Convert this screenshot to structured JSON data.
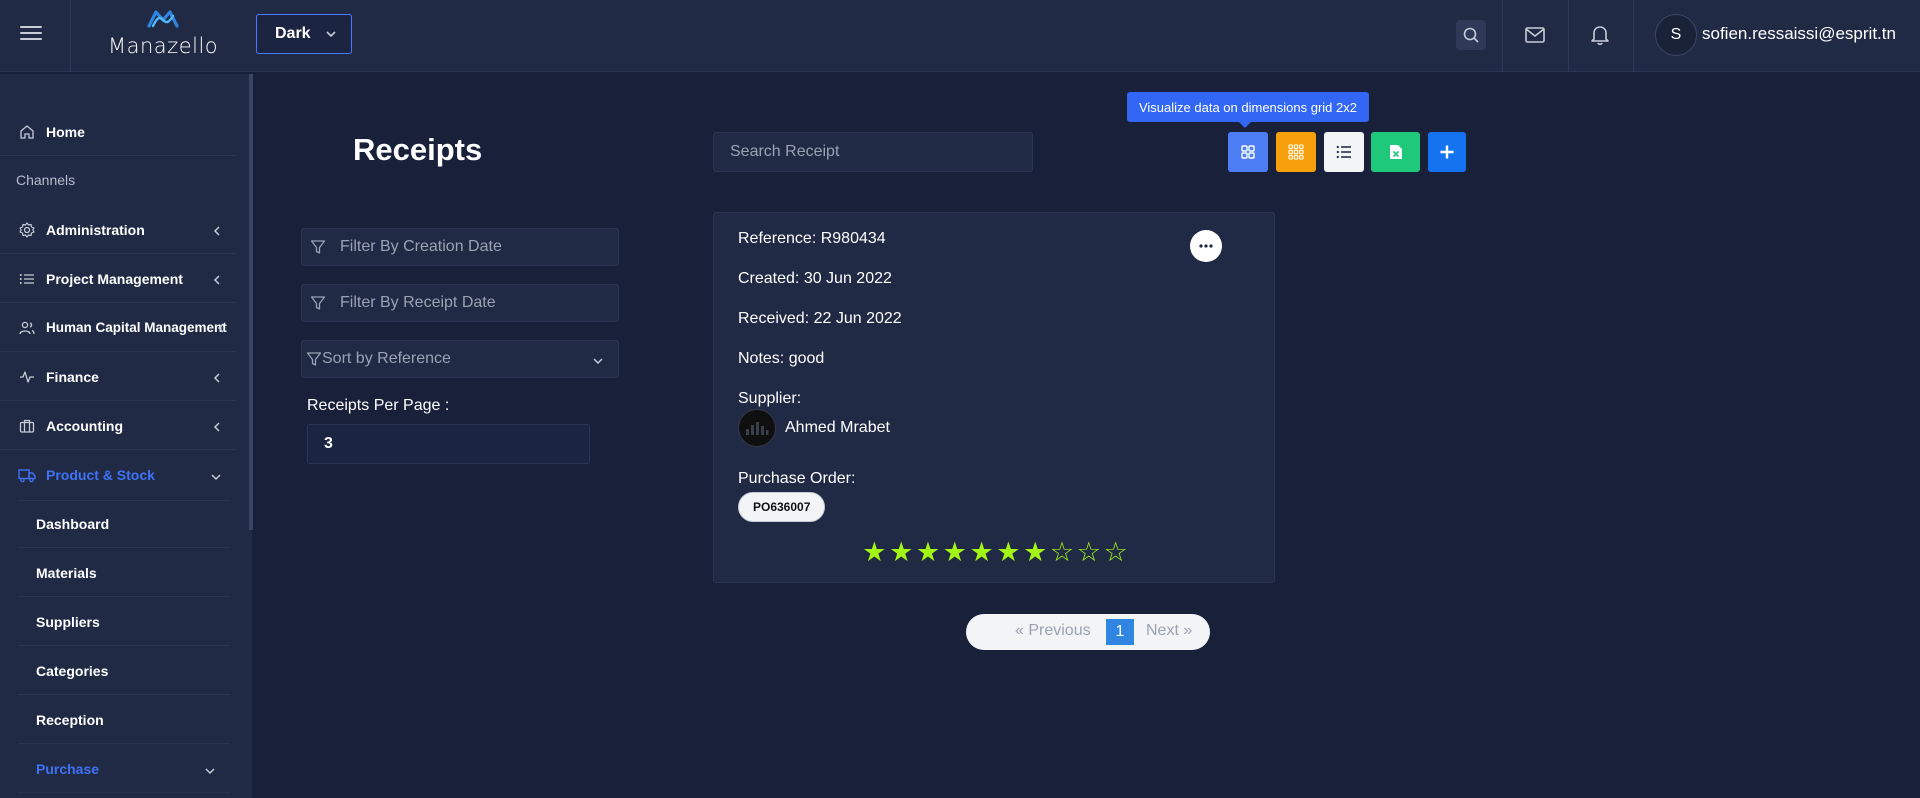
{
  "header": {
    "logo_text": "Manazello",
    "theme_value": "Dark",
    "user_initial": "S",
    "user_email": "sofien.ressaissi@esprit.tn",
    "icons": [
      "menu-icon",
      "search-icon",
      "mail-icon",
      "bell-icon"
    ]
  },
  "sidebar": {
    "home": "Home",
    "section_label": "Channels",
    "items": [
      {
        "label": "Administration",
        "icon": "settings-icon"
      },
      {
        "label": "Project Management",
        "icon": "list-icon"
      },
      {
        "label": "Human Capital Management",
        "icon": "users-icon"
      },
      {
        "label": "Finance",
        "icon": "activity-icon"
      },
      {
        "label": "Accounting",
        "icon": "briefcase-icon"
      },
      {
        "label": "Product & Stock",
        "icon": "truck-icon",
        "active": true
      }
    ],
    "sub_items": [
      "Dashboard",
      "Materials",
      "Suppliers",
      "Categories",
      "Reception",
      "Purchase"
    ],
    "active_sub_item": "Purchase"
  },
  "main": {
    "title": "Receipts",
    "search_placeholder": "Search Receipt",
    "tooltip": "Visualize data on dimensions grid 2x2",
    "view_buttons": [
      {
        "name": "grid-2x2",
        "color": "#4d7ef5"
      },
      {
        "name": "grid-3x3",
        "color": "#f5a00b"
      },
      {
        "name": "list",
        "color": "#f3f4f6"
      },
      {
        "name": "export-excel",
        "color": "#1ec97b"
      },
      {
        "name": "add",
        "color": "#1673f0"
      }
    ],
    "filters": {
      "creation_date_placeholder": "Filter By Creation Date",
      "receipt_date_placeholder": "Filter By Receipt Date",
      "sort_label": "Sort by Reference"
    },
    "per_page_label": "Receipts Per Page :",
    "per_page_value": "3"
  },
  "card": {
    "reference": "Reference: R980434",
    "created": "Created: 30 Jun 2022",
    "received": "Received: 22 Jun 2022",
    "notes": "Notes: good",
    "supplier_label": "Supplier:",
    "supplier_name": "Ahmed Mrabet",
    "purchase_order_label": "Purchase Order:",
    "purchase_order": "PO636007",
    "rating": 7,
    "rating_max": 10
  },
  "pagination": {
    "previous": "«  Previous",
    "current": "1",
    "next": "Next  »"
  }
}
